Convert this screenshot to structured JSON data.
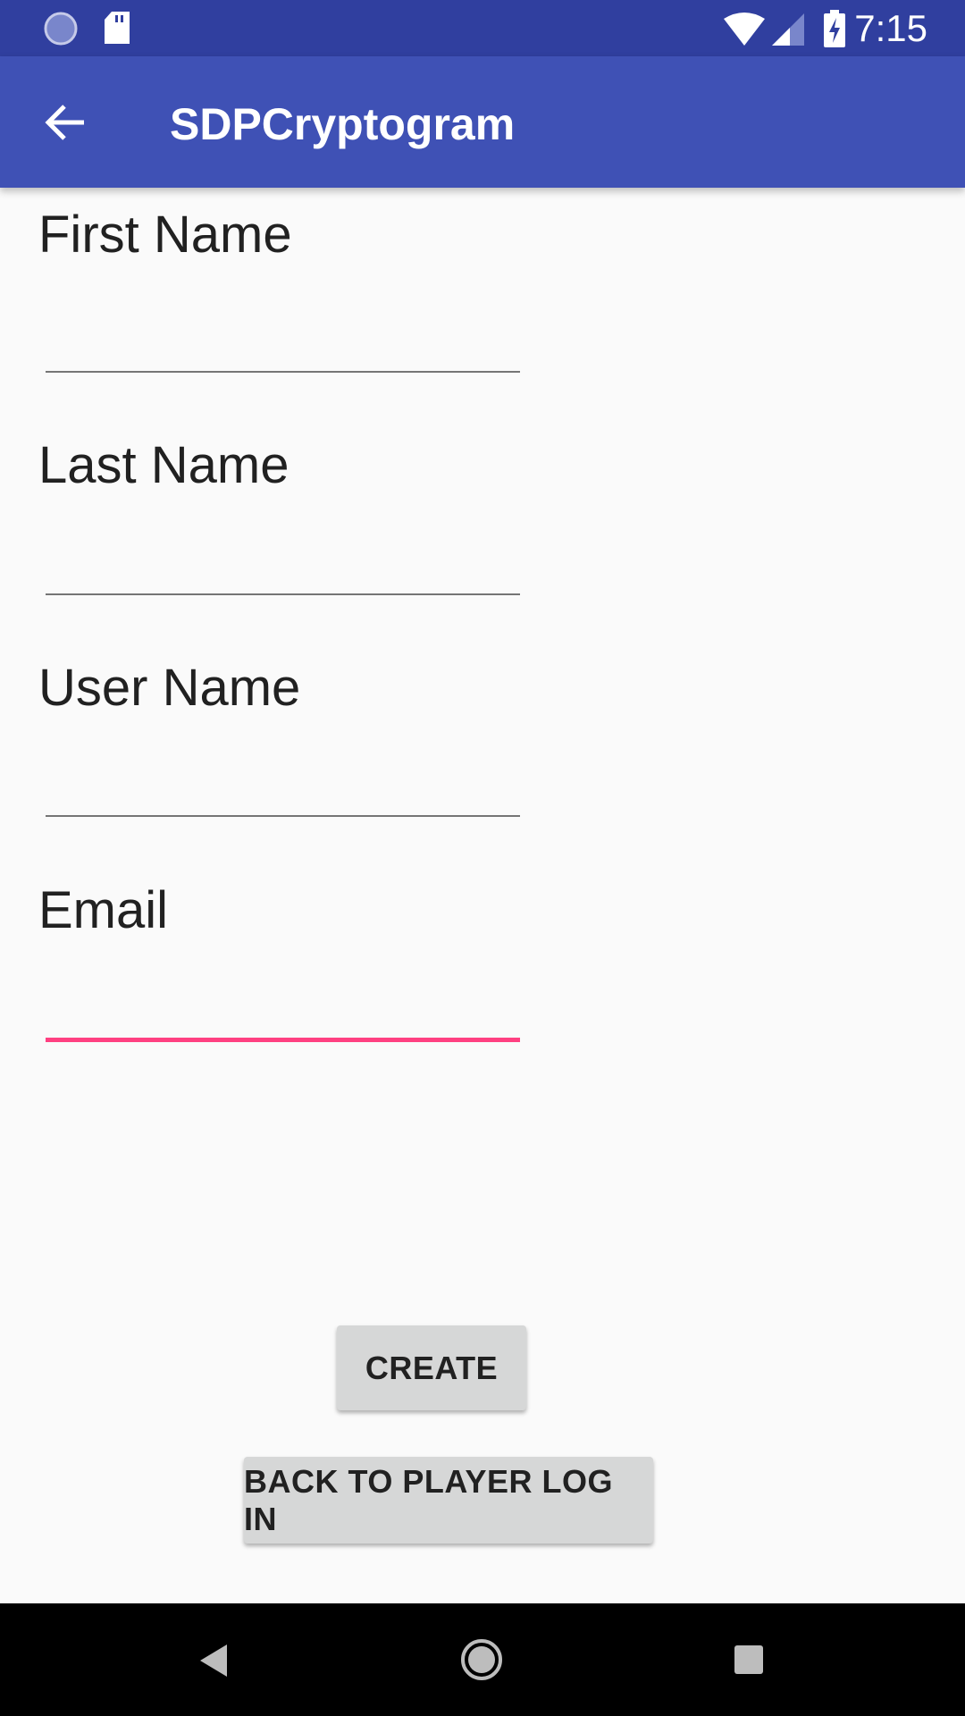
{
  "status_bar": {
    "time": "7:15",
    "icons": [
      "sync-icon",
      "sd-card-icon",
      "wifi-icon",
      "signal-icon",
      "battery-charging-icon"
    ]
  },
  "app_bar": {
    "title": "SDPCryptogram",
    "back_icon": "arrow-back-icon"
  },
  "form": {
    "fields": [
      {
        "label": "First Name",
        "value": ""
      },
      {
        "label": "Last Name",
        "value": ""
      },
      {
        "label": "User Name",
        "value": ""
      },
      {
        "label": "Email",
        "value": ""
      }
    ]
  },
  "buttons": {
    "create": "CREATE",
    "back_to_login": "BACK TO PLAYER LOG IN"
  },
  "colors": {
    "primary": "#3f51b5",
    "primary_dark": "#303f9f",
    "accent": "#ff4081"
  }
}
